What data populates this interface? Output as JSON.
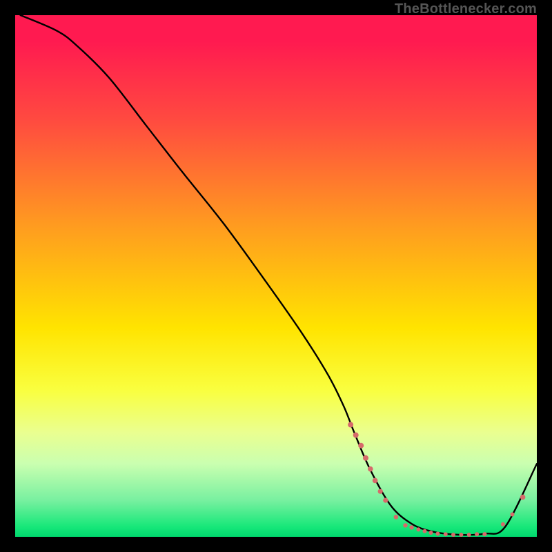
{
  "attribution": "TheBottlenecker.com",
  "colors": {
    "top": "#ff1a50",
    "mid": "#ffe400",
    "bottom": "#00d86e",
    "line": "#000000",
    "marker": "#d66a6a",
    "background": "#000000"
  },
  "chart_data": {
    "type": "line",
    "title": "",
    "xlabel": "",
    "ylabel": "",
    "xlim": [
      0,
      100
    ],
    "ylim": [
      0,
      100
    ],
    "series": [
      {
        "name": "curve",
        "x": [
          1,
          8,
          12,
          18,
          25,
          32,
          40,
          48,
          55,
          60,
          63,
          65,
          68,
          72,
          76,
          80,
          85,
          90,
          94,
          100
        ],
        "values": [
          100,
          97,
          94,
          88,
          79,
          70,
          60,
          49,
          39,
          31,
          25,
          20,
          13,
          6,
          2.5,
          1,
          0.4,
          0.6,
          2,
          14
        ]
      }
    ],
    "markers": [
      {
        "x": 64.3,
        "y": 21.5,
        "r": 4.0
      },
      {
        "x": 65.3,
        "y": 19.5,
        "r": 4.0
      },
      {
        "x": 66.3,
        "y": 17.5,
        "r": 4.0
      },
      {
        "x": 67.2,
        "y": 15.1,
        "r": 4.0
      },
      {
        "x": 68.1,
        "y": 13.0,
        "r": 3.8
      },
      {
        "x": 69.0,
        "y": 10.8,
        "r": 3.8
      },
      {
        "x": 70.0,
        "y": 8.7,
        "r": 3.6
      },
      {
        "x": 71.0,
        "y": 7.0,
        "r": 3.6
      },
      {
        "x": 73.0,
        "y": 3.8,
        "r": 3.3
      },
      {
        "x": 74.8,
        "y": 2.2,
        "r": 3.2
      },
      {
        "x": 76.0,
        "y": 1.8,
        "r": 3.2
      },
      {
        "x": 77.3,
        "y": 1.4,
        "r": 3.0
      },
      {
        "x": 78.5,
        "y": 1.1,
        "r": 3.0
      },
      {
        "x": 79.7,
        "y": 0.8,
        "r": 3.0
      },
      {
        "x": 81.0,
        "y": 0.6,
        "r": 3.0
      },
      {
        "x": 82.5,
        "y": 0.5,
        "r": 3.0
      },
      {
        "x": 84.0,
        "y": 0.4,
        "r": 3.0
      },
      {
        "x": 85.5,
        "y": 0.4,
        "r": 3.0
      },
      {
        "x": 87.0,
        "y": 0.4,
        "r": 3.0
      },
      {
        "x": 88.5,
        "y": 0.5,
        "r": 3.0
      },
      {
        "x": 90.0,
        "y": 0.5,
        "r": 3.1
      },
      {
        "x": 93.5,
        "y": 2.4,
        "r": 3.0
      },
      {
        "x": 95.3,
        "y": 4.3,
        "r": 3.0
      },
      {
        "x": 97.3,
        "y": 7.6,
        "r": 3.8
      }
    ]
  }
}
